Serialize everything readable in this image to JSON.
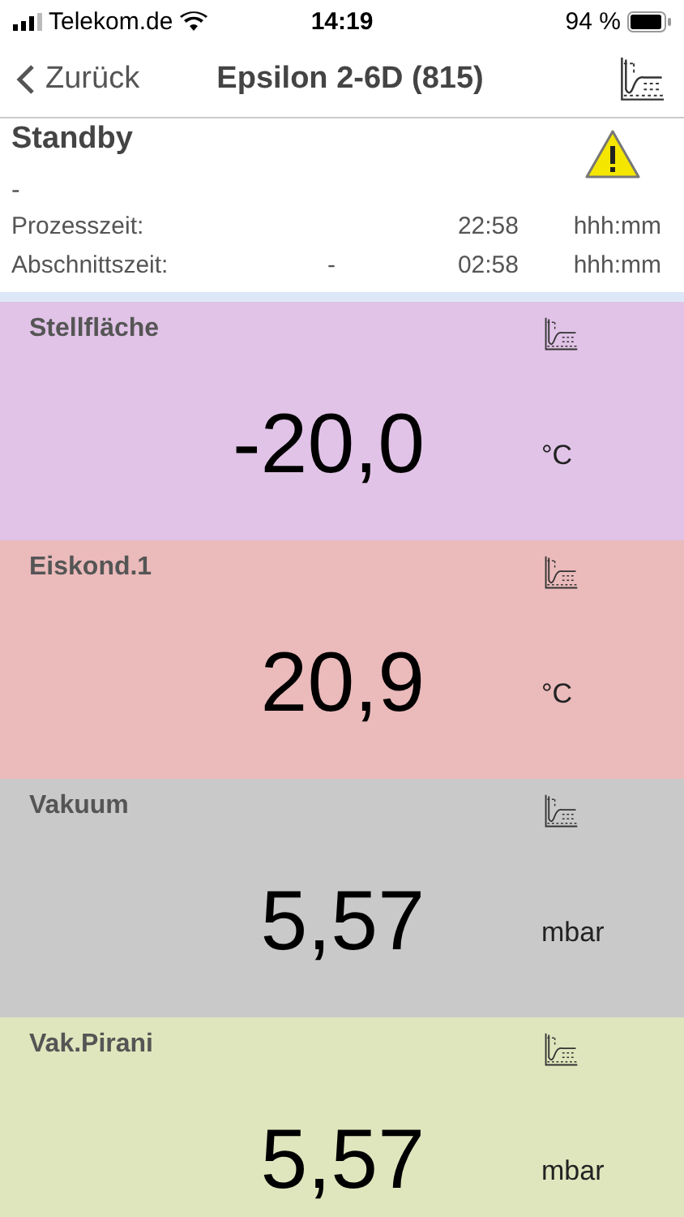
{
  "status_bar": {
    "carrier": "Telekom.de",
    "time": "14:19",
    "battery": "94 %"
  },
  "nav": {
    "back": "Zurück",
    "title": "Epsilon 2-6D (815)"
  },
  "status": {
    "title": "Standby",
    "phase": "-",
    "warning": true
  },
  "times": [
    {
      "label": "Prozesszeit:",
      "value": "22:58",
      "unit": "hhh:mm"
    },
    {
      "label": "Abschnittszeit:",
      "step": "-",
      "value": "02:58",
      "unit": "hhh:mm"
    }
  ],
  "sensors": [
    {
      "name": "Stellfläche",
      "value": "-20,0",
      "unit": "°C",
      "color": "#e0c3e6"
    },
    {
      "name": "Eiskond.1",
      "value": "20,9",
      "unit": "°C",
      "color": "#ebbabb"
    },
    {
      "name": "Vakuum",
      "value": "5,57",
      "unit": "mbar",
      "color": "#c9c9c9"
    },
    {
      "name": "Vak.Pirani",
      "value": "5,57",
      "unit": "mbar",
      "color": "#dfe6bd"
    }
  ]
}
